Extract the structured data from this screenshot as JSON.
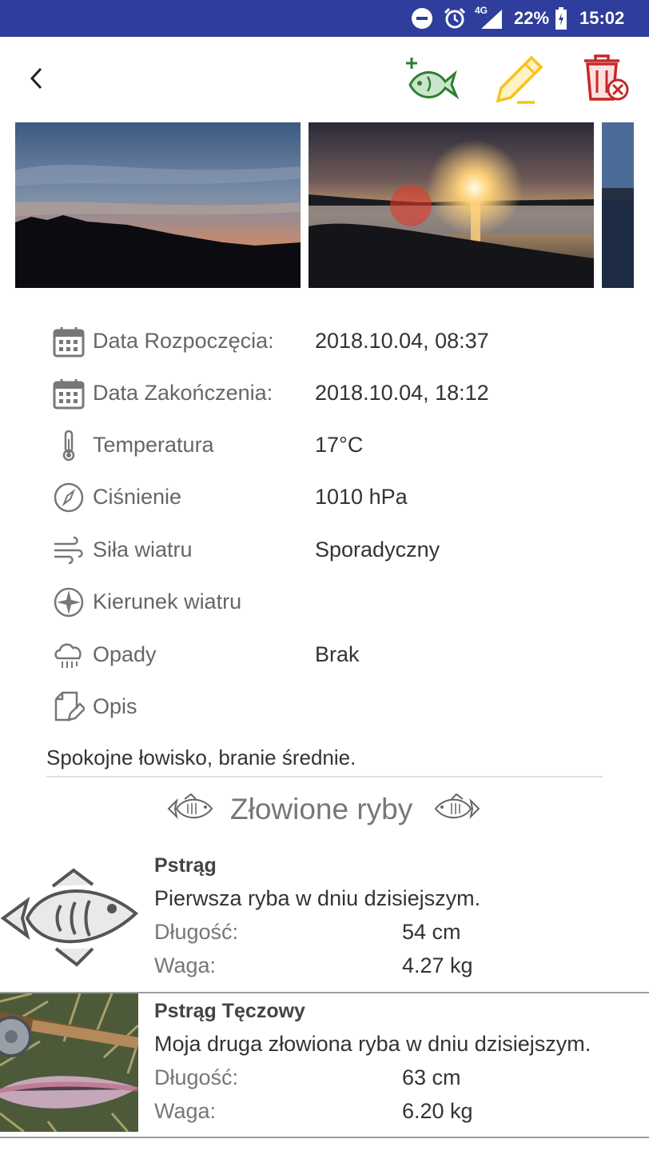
{
  "status_bar": {
    "network": "4G",
    "battery": "22%",
    "time": "15:02",
    "icons": [
      "do-not-disturb-icon",
      "alarm-icon",
      "signal-icon",
      "battery-charging-icon"
    ]
  },
  "toolbar": {
    "back_icon": "chevron-left-icon",
    "actions": [
      "add-fish-icon",
      "edit-pencil-icon",
      "delete-trash-icon"
    ],
    "colors": {
      "add": "#2e7d32",
      "edit": "#f9c21b",
      "delete": "#c62828"
    }
  },
  "details": [
    {
      "icon": "calendar-icon",
      "label": "Data Rozpoczęcia:",
      "value": "2018.10.04,  08:37"
    },
    {
      "icon": "calendar-icon",
      "label": "Data Zakończenia:",
      "value": "2018.10.04,  18:12"
    },
    {
      "icon": "thermometer-icon",
      "label": "Temperatura",
      "value": "17°C"
    },
    {
      "icon": "compass-gauge-icon",
      "label": "Ciśnienie",
      "value": "1010 hPa"
    },
    {
      "icon": "wind-icon",
      "label": "Siła wiatru",
      "value": "Sporadyczny"
    },
    {
      "icon": "wind-rose-icon",
      "label": "Kierunek wiatru",
      "value": ""
    },
    {
      "icon": "rain-cloud-icon",
      "label": "Opady",
      "value": "Brak"
    },
    {
      "icon": "note-pencil-icon",
      "label": "Opis",
      "value": ""
    }
  ],
  "description": "Spokojne łowisko, branie średnie.",
  "section_title": "Złowione ryby",
  "fish": [
    {
      "name": "Pstrąg",
      "desc": "Pierwsza ryba w dniu dzisiejszym.",
      "length_label": "Długość:",
      "length": "54 cm",
      "weight_label": "Waga:",
      "weight": "4.27 kg"
    },
    {
      "name": "Pstrąg Tęczowy",
      "desc": "Moja druga złowiona ryba w dniu dzisiejszym.",
      "length_label": "Długość:",
      "length": "63 cm",
      "weight_label": "Waga:",
      "weight": "6.20 kg"
    }
  ]
}
